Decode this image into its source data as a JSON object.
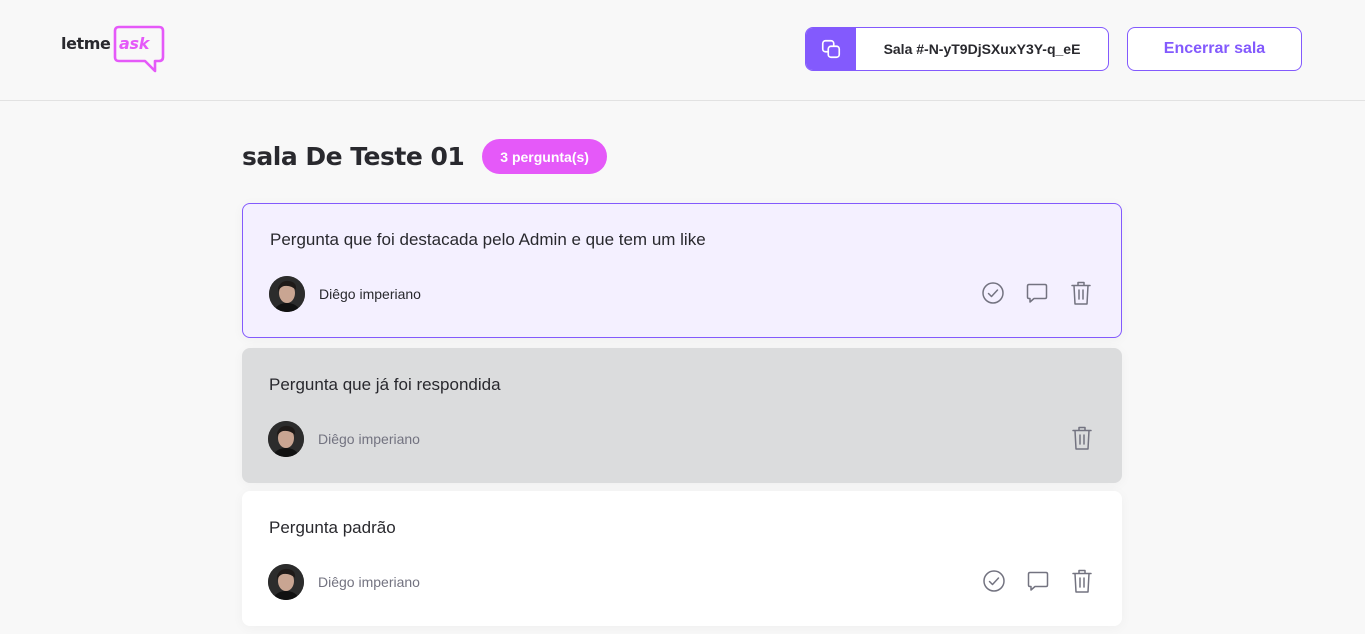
{
  "logo": {
    "part1": "letme",
    "part2": "ask"
  },
  "header": {
    "room_code_label": "Sala #-N-yT9DjSXuxY3Y-q_eE",
    "end_room_label": "Encerrar sala"
  },
  "room": {
    "title": "sala De Teste 01",
    "question_count": "3 pergunta(s)"
  },
  "questions": [
    {
      "content": "Pergunta que foi destacada pelo Admin e que tem um like",
      "author": "Diêgo imperiano",
      "state": "highlighted"
    },
    {
      "content": "Pergunta que já foi respondida",
      "author": "Diêgo imperiano",
      "state": "answered"
    },
    {
      "content": "Pergunta padrão",
      "author": "Diêgo imperiano",
      "state": "default"
    }
  ],
  "colors": {
    "accent": "#835afd",
    "pink": "#e559f9",
    "text": "#29292e",
    "muted": "#737380"
  },
  "icons": [
    "copy-icon",
    "check-circle-icon",
    "answer-bubble-icon",
    "trash-icon"
  ]
}
